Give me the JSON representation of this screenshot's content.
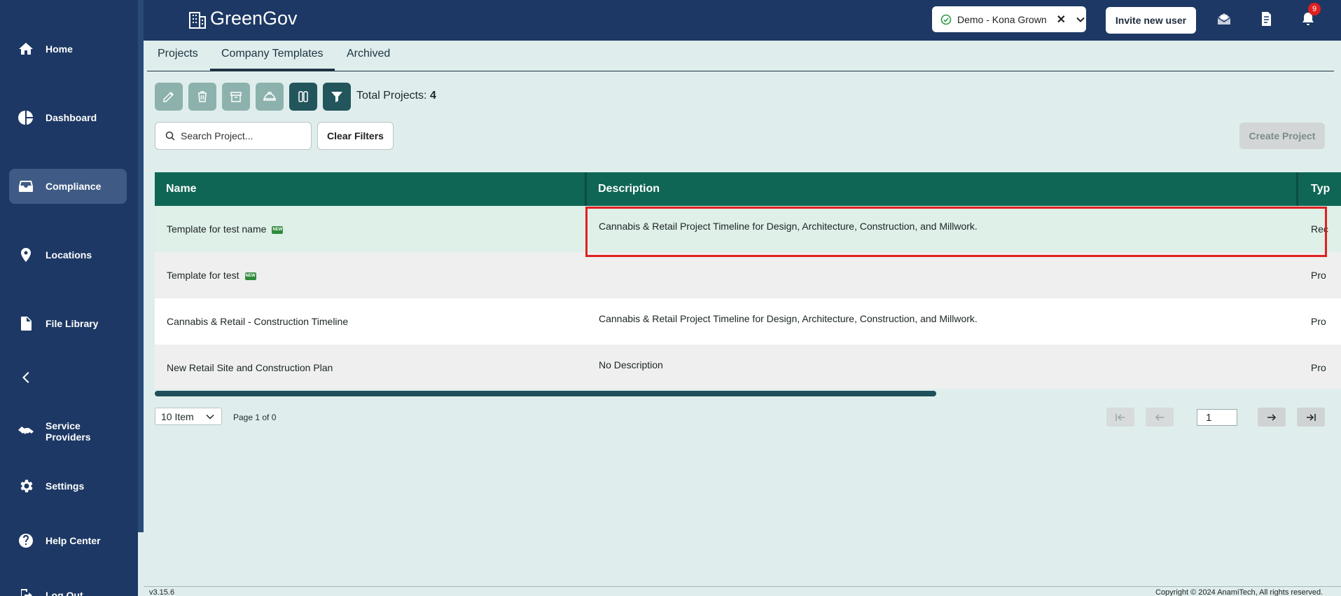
{
  "app": {
    "brand": "GreenGov"
  },
  "sidebar": {
    "items": [
      {
        "label": "Home",
        "icon": "home-icon"
      },
      {
        "label": "Dashboard",
        "icon": "pie-chart-icon"
      },
      {
        "label": "Compliance",
        "icon": "inbox-tray-icon",
        "active": true
      },
      {
        "label": "Locations",
        "icon": "location-pin-icon"
      },
      {
        "label": "File Library",
        "icon": "file-icon"
      },
      {
        "label": "",
        "icon": "chevron-left-icon"
      },
      {
        "label": "Service Providers",
        "icon": "handshake-icon"
      },
      {
        "label": "Settings",
        "icon": "gear-icon"
      },
      {
        "label": "Help Center",
        "icon": "help-circle-icon"
      },
      {
        "label": "Log Out",
        "icon": "logout-icon"
      }
    ]
  },
  "header": {
    "company": "Demo - Kona Grown",
    "clear_symbol": "✕",
    "invite_label": "Invite new user",
    "notification_count": "9"
  },
  "tabs": [
    {
      "label": "Projects"
    },
    {
      "label": "Company Templates",
      "active": true
    },
    {
      "label": "Archived"
    }
  ],
  "toolbar": {
    "total_label": "Total Projects:",
    "total_value": "4"
  },
  "search": {
    "placeholder": "Search Project..."
  },
  "clear_filters_label": "Clear Filters",
  "create_project_label": "Create Project",
  "table": {
    "columns": [
      "Name",
      "Description",
      "Typ"
    ],
    "rows": [
      {
        "name": "Template for test name",
        "new": true,
        "description": "Cannabis & Retail Project Timeline for Design, Architecture, Construction, and Millwork.",
        "type": "Rec"
      },
      {
        "name": "Template for test",
        "new": true,
        "description": "",
        "type": "Pro"
      },
      {
        "name": "Cannabis & Retail - Construction Timeline",
        "new": false,
        "description": "Cannabis & Retail Project Timeline for Design, Architecture, Construction, and Millwork.",
        "type": "Pro"
      },
      {
        "name": "New Retail Site and Construction Plan",
        "new": false,
        "description": "No Description",
        "type": "Pro"
      }
    ],
    "new_badge": "NEW"
  },
  "pagination": {
    "page_size": "10 Item",
    "page_info": "Page 1 of 0",
    "current_page": "1"
  },
  "footer": {
    "version": "v3.15.6",
    "copyright": "Copyright © 2024 AnamiTech, All rights reserved."
  },
  "colors": {
    "sidebar": "#1d3864",
    "table_header": "#0f6655",
    "highlight": "#e02020",
    "background": "#dfeeec"
  }
}
